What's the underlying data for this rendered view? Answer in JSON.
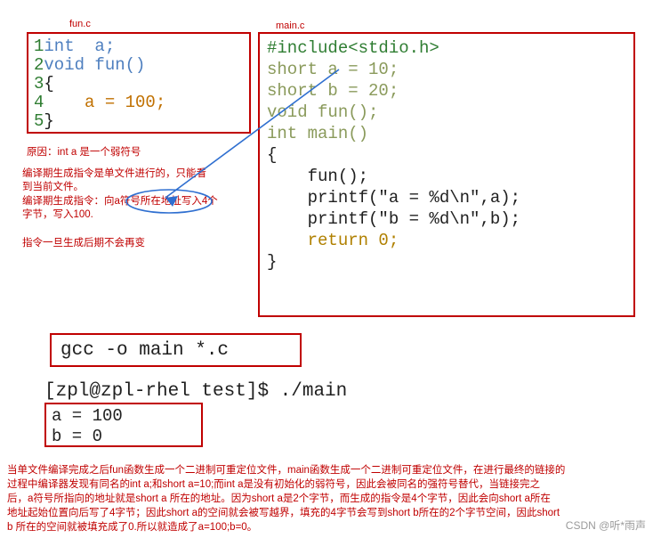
{
  "captions": {
    "fun_c": "fun.c",
    "main_c": "main.c"
  },
  "fun_code": {
    "lines": [
      {
        "no": "1",
        "code": "int  a;"
      },
      {
        "no": "2",
        "code": "void fun()"
      },
      {
        "no": "3",
        "code": "{"
      },
      {
        "no": "4",
        "code": "    a = 100;"
      },
      {
        "no": "5",
        "code": "}"
      }
    ]
  },
  "main_code": {
    "lines": [
      "#include<stdio.h>",
      "short a = 10;",
      "short b = 20;",
      "",
      "void fun();",
      "int main()",
      "{",
      "",
      "    fun();",
      "    printf(\"a = %d\\n\",a);",
      "    printf(\"b = %d\\n\",b);",
      "    return 0;",
      "}"
    ]
  },
  "annotations": {
    "line1": "原因：int a 是一个弱符号",
    "line2": "编译期生成指令是单文件进行的，只能看",
    "line3": "到当前文件。",
    "line4": "编译期生成指令：向a符号所在地址写入4个",
    "line5": "字节，写入100.",
    "line6": "指令一旦生成后期不会再变"
  },
  "terminal": {
    "gcc_command": "gcc -o main *.c",
    "prompt": "[zpl@zpl-rhel test]$ ./main",
    "output_line1": "a = 100",
    "output_line2": "b = 0"
  },
  "bottom_text": {
    "line1": "当单文件编译完成之后fun函数生成一个二进制可重定位文件，main函数生成一个二进制可重定位文件，在进行最终的链接的",
    "line2": "过程中编译器发现有同名的int a;和short a=10;而int a是没有初始化的弱符号，因此会被同名的强符号替代，当链接完之",
    "line3": "后，a符号所指向的地址就是short a 所在的地址。因为short a是2个字节，而生成的指令是4个字节，因此会向short a所在",
    "line4": "地址起始位置向后写了4字节；因此short a的空间就会被写越界，填充的4字节会写到short b所在的2个字节空间，因此short",
    "line5": "b 所在的空间就被填充成了0.所以就造成了a=100;b=0。"
  },
  "watermark": "CSDN @听*雨声",
  "colors": {
    "box_border": "#c00000",
    "annotation": "#c00000",
    "arrow": "#2f6fd0"
  },
  "arrow": {
    "name": "blue-arrow",
    "from": "main.c short a",
    "to": "annotation a符号"
  }
}
